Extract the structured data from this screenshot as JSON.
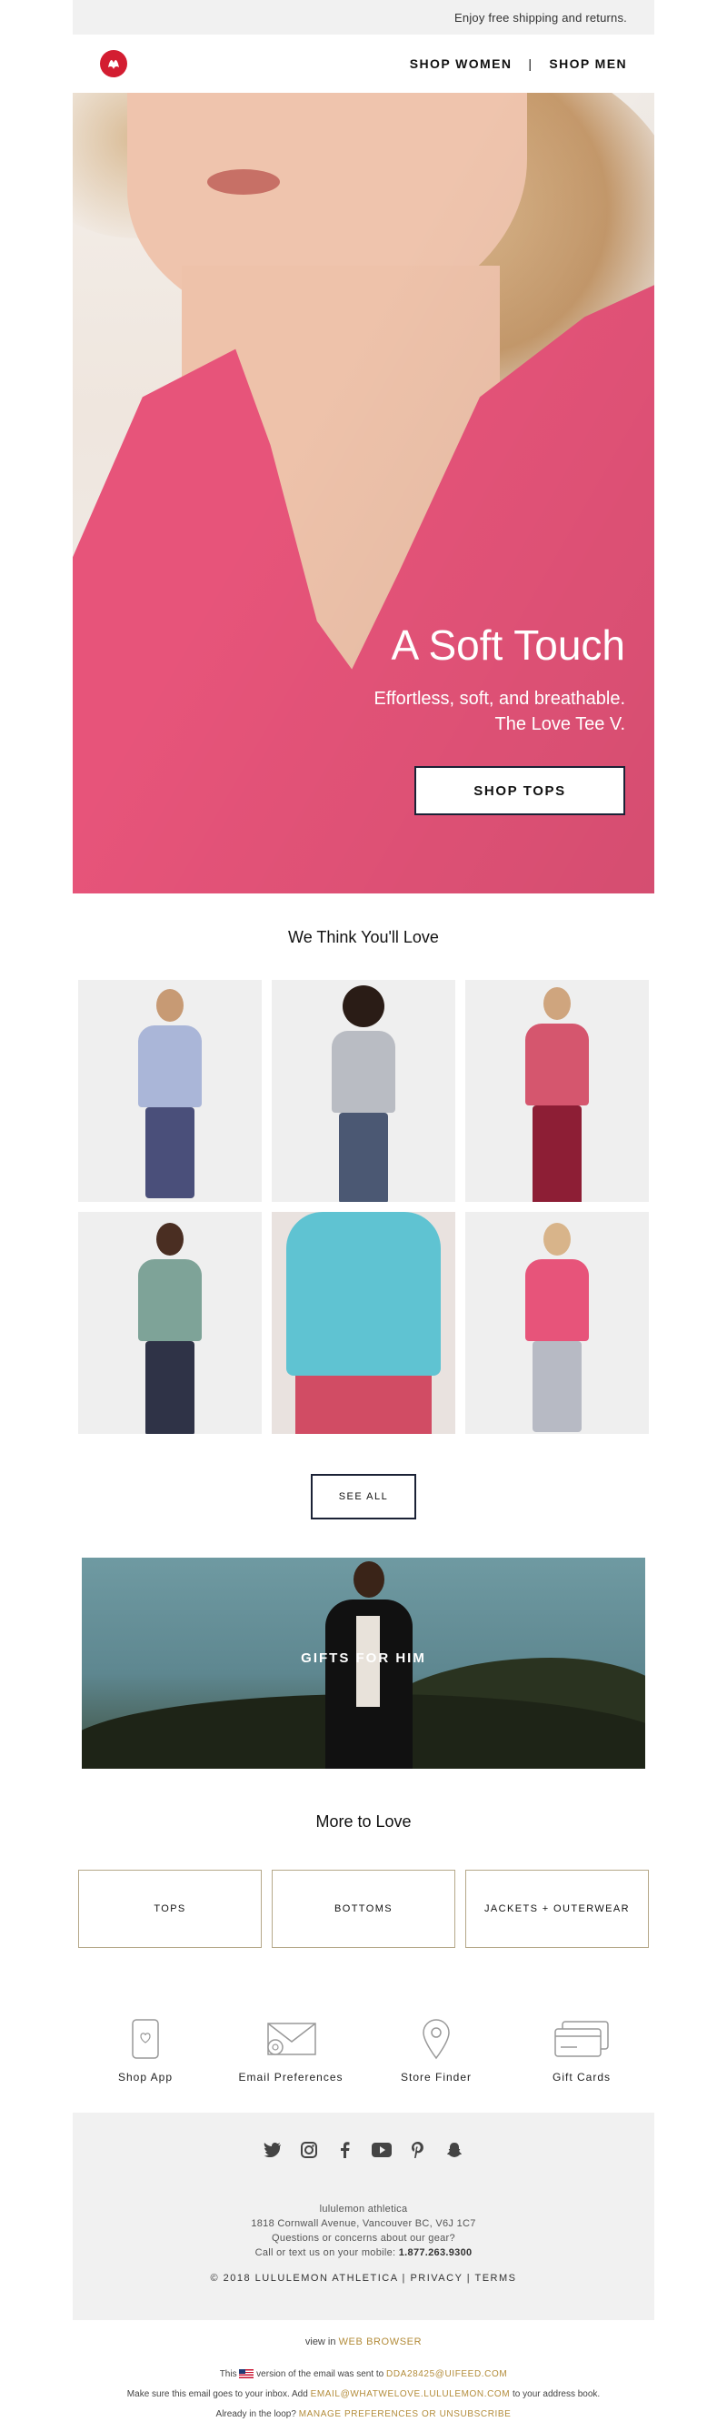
{
  "topbar": {
    "text": "Enjoy free shipping and returns."
  },
  "nav": {
    "shop_women": "SHOP WOMEN",
    "separator": "|",
    "shop_men": "SHOP MEN"
  },
  "hero": {
    "title": "A Soft Touch",
    "subtitle_line1": "Effortless, soft, and breathable.",
    "subtitle_line2": "The Love Tee V.",
    "cta": "SHOP TOPS"
  },
  "recommend": {
    "heading": "We Think You'll Love",
    "see_all": "SEE ALL"
  },
  "gifts": {
    "label": "GIFTS FOR HIM"
  },
  "more": {
    "heading": "More to Love",
    "categories": [
      "TOPS",
      "BOTTOMS",
      "JACKETS + OUTERWEAR"
    ]
  },
  "utilities": [
    "Shop App",
    "Email Preferences",
    "Store Finder",
    "Gift Cards"
  ],
  "footer": {
    "company": "lululemon athletica",
    "address": "1818 Cornwall Avenue, Vancouver BC, V6J 1C7",
    "questions": "Questions or concerns about our gear?",
    "call_prefix": "Call or text us on your mobile:",
    "phone": "1.877.263.9300",
    "copyright": "© 2018 LULULEMON ATHLETICA",
    "privacy": "PRIVACY",
    "terms": "TERMS"
  },
  "bottom": {
    "view_in": "view in",
    "web_browser": "WEB BROWSER",
    "this": "This",
    "version_text": "version of the email was sent to",
    "email": "DDA28425@UIFEED.COM",
    "inbox_text": "Make sure this email goes to your inbox. Add",
    "sender": "EMAIL@WHATWELOVE.LULULEMON.COM",
    "addressbook_text": "to your address book.",
    "loop_text": "Already in the loop?",
    "manage": "MANAGE PREFERENCES OR UNSUBSCRIBE"
  },
  "colors": {
    "accent": "#d31d31",
    "hero_pink": "#e7547a",
    "link_gold": "#b38c3a",
    "navy": "#1b2236"
  }
}
